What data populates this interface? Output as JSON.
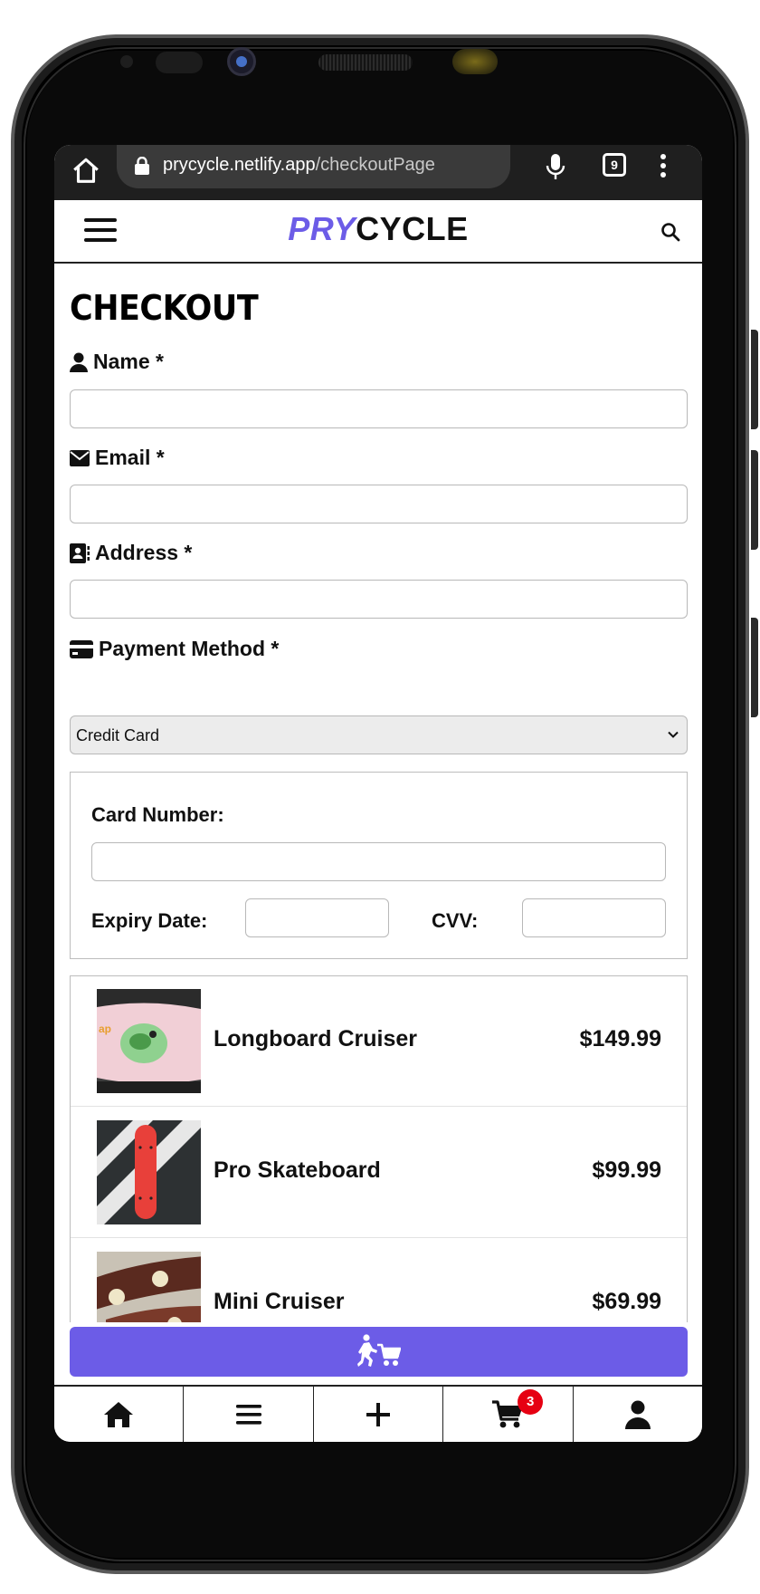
{
  "browser": {
    "url_domain": "prycycle.netlify.app",
    "url_path": "/checkoutPage",
    "tab_count": "9"
  },
  "header": {
    "logo_part1": "PRY",
    "logo_part2": "CYCLE"
  },
  "page": {
    "title": "CHECKOUT"
  },
  "form": {
    "name_label": "Name *",
    "email_label": "Email *",
    "address_label": "Address *",
    "payment_label": "Payment Method *",
    "payment_selected": "Credit Card",
    "card_number_label": "Card Number:",
    "expiry_label": "Expiry Date:",
    "cvv_label": "CVV:"
  },
  "cart": {
    "items": [
      {
        "name": "Longboard Cruiser",
        "price": "$149.99"
      },
      {
        "name": "Pro Skateboard",
        "price": "$99.99"
      },
      {
        "name": "Mini Cruiser",
        "price": "$69.99"
      }
    ],
    "count": "3"
  },
  "colors": {
    "brand": "#6c5ce7",
    "badge": "#e60012"
  },
  "icons": {
    "nav": [
      "home-icon",
      "list-icon",
      "plus-icon",
      "cart-icon",
      "user-icon"
    ],
    "checkout": "checkout-shopping-icon"
  }
}
